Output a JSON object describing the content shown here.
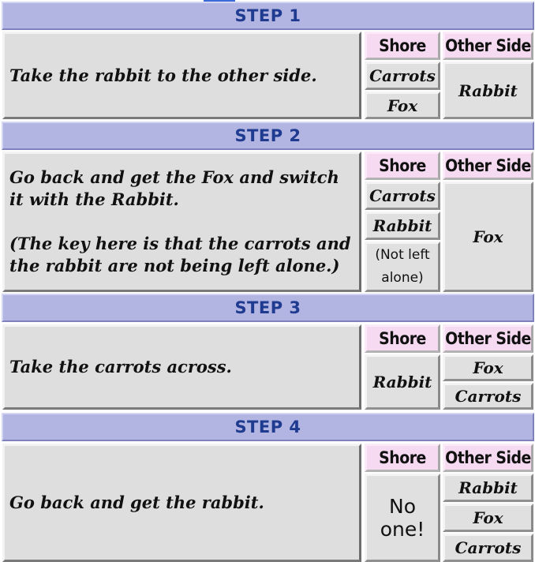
{
  "columns": {
    "shore": "Shore",
    "other_side": "Other Side"
  },
  "steps": [
    {
      "title": "STEP 1",
      "description": "Take the rabbit to the other side.",
      "shore": [
        "Carrots",
        "Fox"
      ],
      "other_side": [
        "Rabbit"
      ]
    },
    {
      "title": "STEP 2",
      "description": "Go back and get the Fox and switch it with the Rabbit.\n\n(The key here is that the carrots and the rabbit are not being left alone.)",
      "shore": [
        "Carrots",
        "Rabbit",
        "(Not left alone)"
      ],
      "other_side": [
        "Fox"
      ]
    },
    {
      "title": "STEP 3",
      "description": "Take the carrots across.",
      "shore": [
        "Rabbit"
      ],
      "other_side": [
        "Fox",
        "Carrots"
      ]
    },
    {
      "title": "STEP 4",
      "description": "Go back and get the rabbit.",
      "shore": [
        "No one!"
      ],
      "other_side": [
        "Rabbit",
        "Fox",
        "Carrots"
      ]
    }
  ]
}
